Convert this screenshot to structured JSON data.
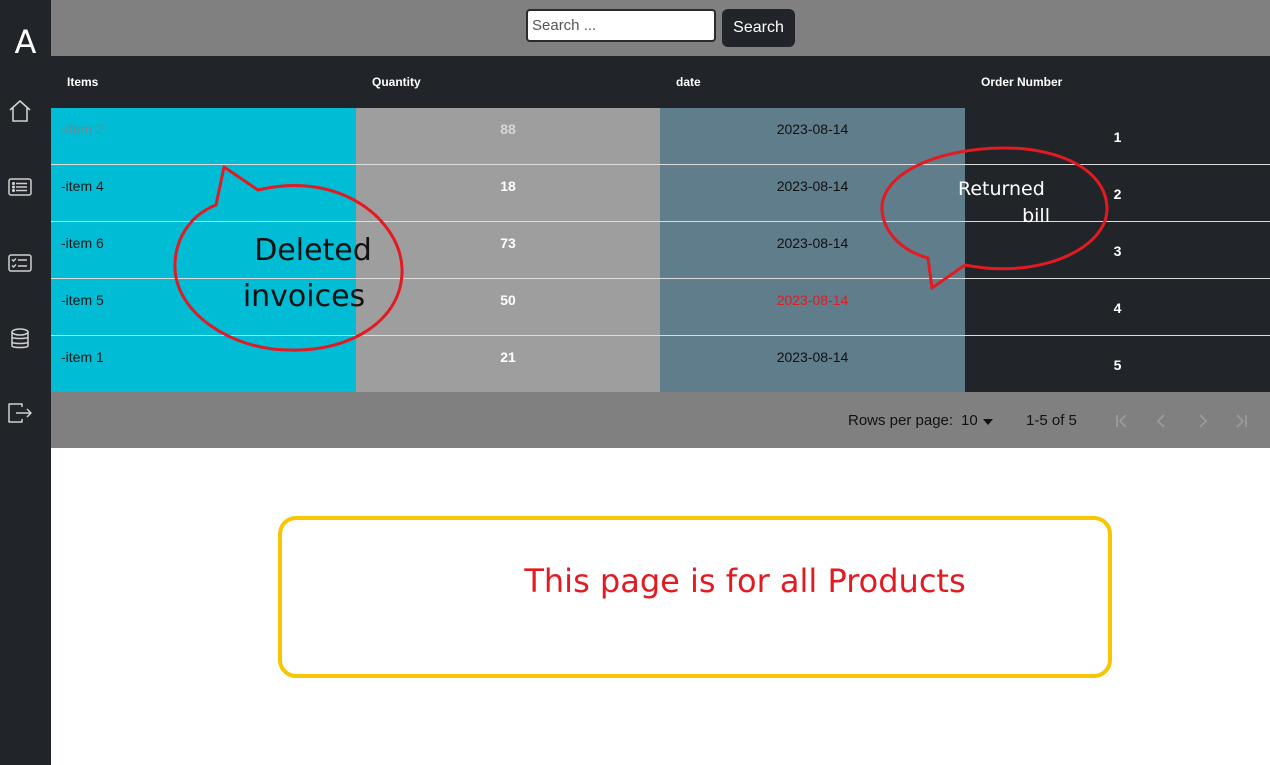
{
  "sidebar": {
    "brand": "A",
    "items": [
      {
        "icon": "home-icon"
      },
      {
        "icon": "list-icon"
      },
      {
        "icon": "checklist-icon"
      },
      {
        "icon": "database-icon"
      },
      {
        "icon": "logout-icon"
      }
    ]
  },
  "search": {
    "placeholder": "Search ...",
    "value": "",
    "button_label": "Search"
  },
  "table": {
    "headers": [
      "Items",
      "Quantity",
      "date",
      "Order Number"
    ],
    "rows": [
      {
        "item": "-item 2",
        "quantity": "88",
        "date": "2023-08-14",
        "order": "1"
      },
      {
        "item": "-item 4",
        "quantity": "18",
        "date": "2023-08-14",
        "order": "2"
      },
      {
        "item": "-item 6",
        "quantity": "73",
        "date": "2023-08-14",
        "order": "3"
      },
      {
        "item": "-item 5",
        "quantity": "50",
        "date": "2023-08-14",
        "order": "4"
      },
      {
        "item": "-item 1",
        "quantity": "21",
        "date": "2023-08-14",
        "order": "5"
      }
    ]
  },
  "pagination": {
    "rows_per_page_label": "Rows per page:",
    "rows_per_page_value": "10",
    "range_label": "1-5 of 5"
  },
  "annotations": {
    "deleted": {
      "line1": "Deleted",
      "line2": "invoices"
    },
    "returned": {
      "line1": "Returned",
      "line2": "bill"
    },
    "info": "This page is for all Products"
  },
  "colors": {
    "sidebar": "#212529",
    "items_column": "#00bcd4",
    "quantity_column": "#9e9e9e",
    "date_column": "#607d8b",
    "order_column": "#212529",
    "highlight_date": "#e21a22",
    "callout_stroke": "#e21a22",
    "info_border": "#f7c600"
  }
}
